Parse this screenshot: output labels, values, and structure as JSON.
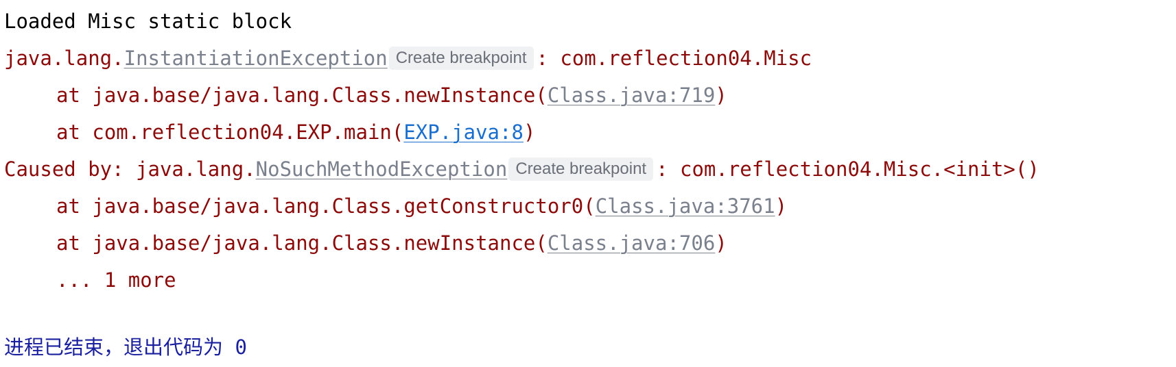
{
  "console": {
    "line1": "Loaded Misc static block",
    "ex1": {
      "prefix": "java.lang.",
      "name": "InstantiationException",
      "breakpoint_label": "Create breakpoint",
      "suffix": ": com.reflection04.Misc"
    },
    "frame1": {
      "prefix": "at java.base/java.lang.Class.newInstance(",
      "link": "Class.java:719",
      "suffix": ")"
    },
    "frame2": {
      "prefix": "at com.reflection04.EXP.main(",
      "link": "EXP.java:8",
      "suffix": ")"
    },
    "ex2": {
      "prefix": "Caused by: java.lang.",
      "name": "NoSuchMethodException",
      "breakpoint_label": "Create breakpoint",
      "suffix": ": com.reflection04.Misc.<init>()"
    },
    "frame3": {
      "prefix": "at java.base/java.lang.Class.getConstructor0(",
      "link": "Class.java:3761",
      "suffix": ")"
    },
    "frame4": {
      "prefix": "at java.base/java.lang.Class.newInstance(",
      "link": "Class.java:706",
      "suffix": ")"
    },
    "more": "... 1 more",
    "exit": "进程已结束，退出代码为 0"
  },
  "colors": {
    "error_text": "#8b0a0a",
    "link_gray": "#7a808c",
    "link_active": "#1a6fce",
    "exit_text": "#1a1f9e",
    "breakpoint_bg": "#f0f1f3"
  }
}
